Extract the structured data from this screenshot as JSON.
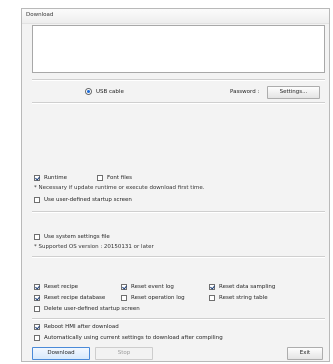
{
  "window": {
    "title": "Download"
  },
  "connection": {
    "method_label": "USB cable",
    "password_label": "Password :",
    "settings_button": "Settings..."
  },
  "options": {
    "runtime": {
      "label": "Runtime",
      "checked": true
    },
    "font_files": {
      "label": "Font files",
      "checked": false
    },
    "runtime_note": "* Necessary if update runtime or execute download first time.",
    "user_startup": {
      "label": "Use user-defined startup screen",
      "checked": false
    },
    "system_settings": {
      "label": "Use system settings file",
      "checked": false
    },
    "os_note": "* Supported OS version : 20150131 or later",
    "reset_recipe": {
      "label": "Reset recipe",
      "checked": true
    },
    "reset_event_log": {
      "label": "Reset event log",
      "checked": true
    },
    "reset_data_sampling": {
      "label": "Reset data sampling",
      "checked": true
    },
    "reset_recipe_db": {
      "label": "Reset recipe database",
      "checked": true
    },
    "reset_operation_log": {
      "label": "Reset operation log",
      "checked": false
    },
    "reset_string_table": {
      "label": "Reset string table",
      "checked": false
    },
    "delete_startup": {
      "label": "Delete user-defined startup screen",
      "checked": false
    },
    "reboot_hmi": {
      "label": "Reboot HMI after download",
      "checked": true
    },
    "auto_current": {
      "label": "Automatically using current settings to download after compiling",
      "checked": false
    }
  },
  "footer": {
    "download_button": "Download",
    "stop_button": "Stop",
    "exit_button": "Exit"
  }
}
